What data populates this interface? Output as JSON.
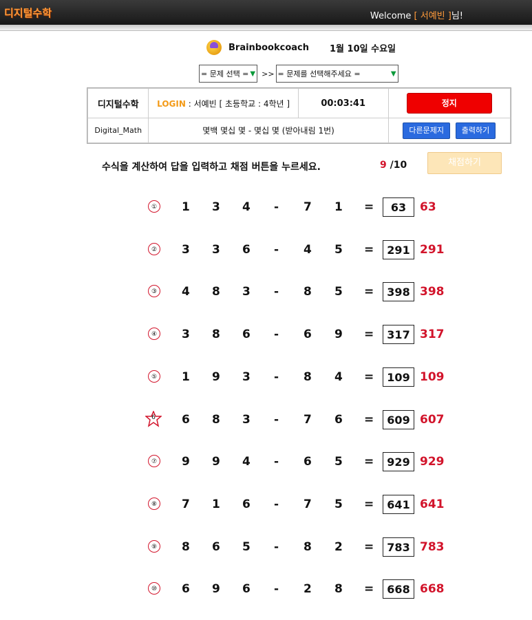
{
  "header": {
    "logo": "디지털수학",
    "welcome_prefix": "Welcome ",
    "welcome_name": "[ 서예빈 ]",
    "welcome_suffix": "님!"
  },
  "brand": {
    "name": "Brainbookcoach",
    "date": "1월 10일 수요일"
  },
  "selectors": {
    "problem_select": "= 문제 선택 =",
    "separator": ">>",
    "problem_select_detail": "= 문제를 선택해주세요 ="
  },
  "panel": {
    "title": "디지털수학",
    "subtitle": "Digital_Math",
    "login_label": "LOGIN",
    "login_value": ": 서예빈 [ 초등학교 : 4학년 ]",
    "timer": "00:03:41",
    "stop_label": "정지",
    "problem_desc": "몇백 몇십 몇 - 몇십 몇 (받아내림 1번)",
    "other_label": "다른문제지",
    "print_label": "출력하기"
  },
  "instruction": "수식을 계산하여 답을 입력하고 채점 버튼을 누르세요.",
  "score": {
    "correct": "9",
    "total": "/10"
  },
  "grade_label": "채점하기",
  "problems": [
    {
      "n": "①",
      "d": [
        "1",
        "3",
        "4"
      ],
      "s": [
        "7",
        "1"
      ],
      "ans": "63",
      "key": "63",
      "wrong": false
    },
    {
      "n": "②",
      "d": [
        "3",
        "3",
        "6"
      ],
      "s": [
        "4",
        "5"
      ],
      "ans": "291",
      "key": "291",
      "wrong": false
    },
    {
      "n": "③",
      "d": [
        "4",
        "8",
        "3"
      ],
      "s": [
        "8",
        "5"
      ],
      "ans": "398",
      "key": "398",
      "wrong": false
    },
    {
      "n": "④",
      "d": [
        "3",
        "8",
        "6"
      ],
      "s": [
        "6",
        "9"
      ],
      "ans": "317",
      "key": "317",
      "wrong": false
    },
    {
      "n": "⑤",
      "d": [
        "1",
        "9",
        "3"
      ],
      "s": [
        "8",
        "4"
      ],
      "ans": "109",
      "key": "109",
      "wrong": false
    },
    {
      "n": "6",
      "d": [
        "6",
        "8",
        "3"
      ],
      "s": [
        "7",
        "6"
      ],
      "ans": "609",
      "key": "607",
      "wrong": true
    },
    {
      "n": "⑦",
      "d": [
        "9",
        "9",
        "4"
      ],
      "s": [
        "6",
        "5"
      ],
      "ans": "929",
      "key": "929",
      "wrong": false
    },
    {
      "n": "⑧",
      "d": [
        "7",
        "1",
        "6"
      ],
      "s": [
        "7",
        "5"
      ],
      "ans": "641",
      "key": "641",
      "wrong": false
    },
    {
      "n": "⑨",
      "d": [
        "8",
        "6",
        "5"
      ],
      "s": [
        "8",
        "2"
      ],
      "ans": "783",
      "key": "783",
      "wrong": false
    },
    {
      "n": "⑩",
      "d": [
        "6",
        "9",
        "6"
      ],
      "s": [
        "2",
        "8"
      ],
      "ans": "668",
      "key": "668",
      "wrong": false
    }
  ],
  "symbols": {
    "minus": "-",
    "equals": "="
  },
  "colors": {
    "accent_red": "#d2142b",
    "login_orange": "#f39a17",
    "stop_red": "#ef0000",
    "button_blue": "#2a6adf"
  }
}
